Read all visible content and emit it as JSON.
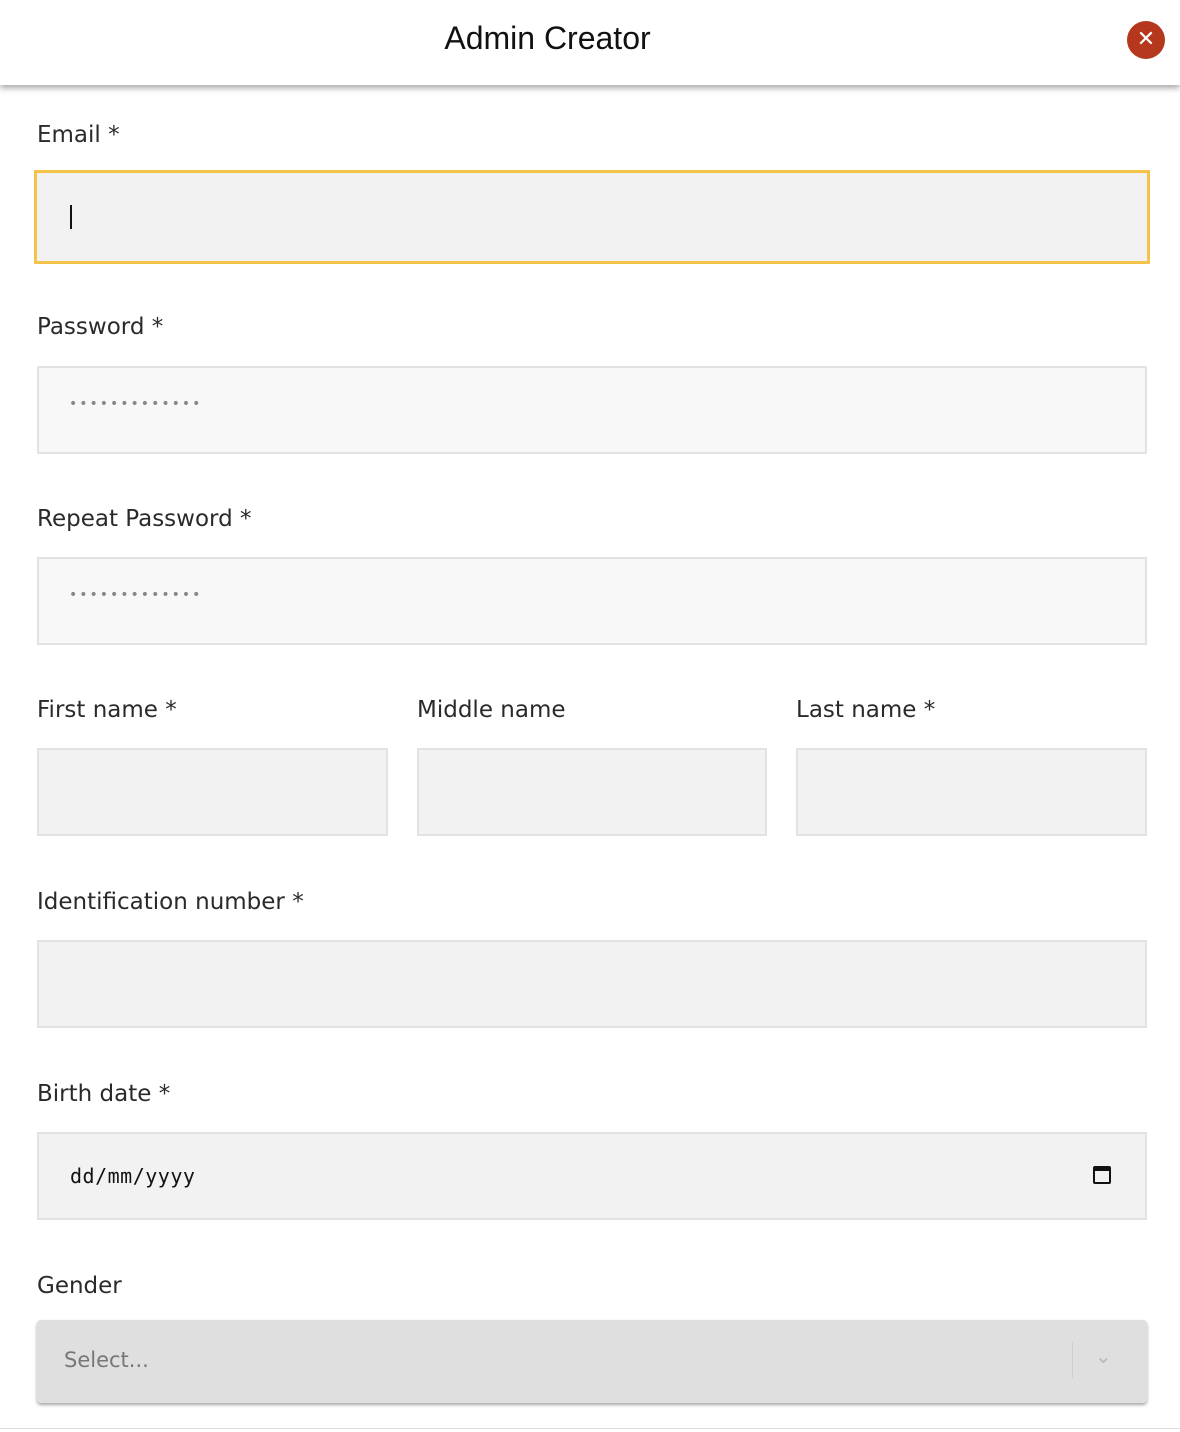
{
  "header": {
    "title": "Admin Creator",
    "close_icon": "close-icon"
  },
  "form": {
    "email": {
      "label": "Email *",
      "value": ""
    },
    "password": {
      "label": "Password *",
      "masked": "•••••••••••••"
    },
    "repeat_password": {
      "label": "Repeat Password *",
      "masked": "•••••••••••••"
    },
    "first_name": {
      "label": "First name *",
      "value": ""
    },
    "middle_name": {
      "label": "Middle name",
      "value": ""
    },
    "last_name": {
      "label": "Last name *",
      "value": ""
    },
    "identification_number": {
      "label": "Identification number *",
      "value": ""
    },
    "birth_date": {
      "label": "Birth date *",
      "placeholder": "dd/mm/yyyy"
    },
    "gender": {
      "label": "Gender",
      "placeholder": "Select..."
    }
  },
  "colors": {
    "close": "#b5371c",
    "focus": "#f3c34a"
  }
}
